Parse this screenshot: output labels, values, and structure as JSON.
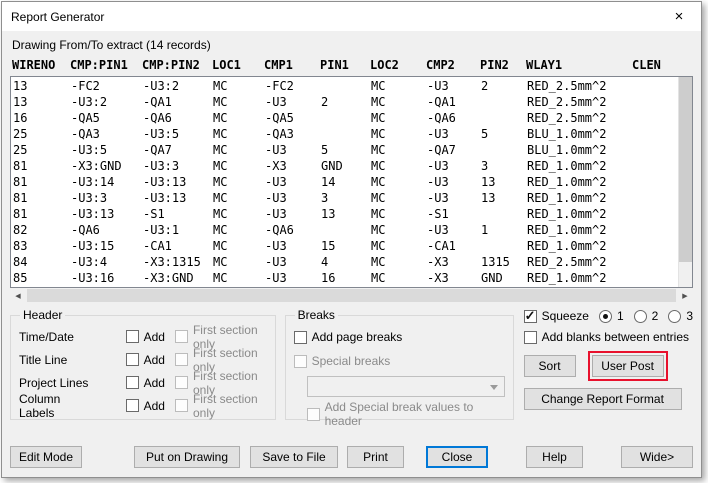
{
  "window": {
    "title": "Report Generator"
  },
  "icons": {
    "close": "×",
    "scroll_left": "◀",
    "scroll_right": "▶"
  },
  "subtitle": "Drawing From/To extract (14 records)",
  "table": {
    "headers": [
      "WIRENO",
      "CMP:PIN1",
      "CMP:PIN2",
      "LOC1",
      "CMP1",
      "PIN1",
      "LOC2",
      "CMP2",
      "PIN2",
      "WLAY1",
      "CLEN"
    ],
    "rows": [
      [
        "13",
        "-FC2",
        "-U3:2",
        "MC",
        "-FC2",
        "",
        "MC",
        "-U3",
        "2",
        "RED_2.5mm^2"
      ],
      [
        "13",
        "-U3:2",
        "-QA1",
        "MC",
        "-U3",
        "2",
        "MC",
        "-QA1",
        "",
        "RED_2.5mm^2"
      ],
      [
        "16",
        "-QA5",
        "-QA6",
        "MC",
        "-QA5",
        "",
        "MC",
        "-QA6",
        "",
        "RED_2.5mm^2"
      ],
      [
        "25",
        "-QA3",
        "-U3:5",
        "MC",
        "-QA3",
        "",
        "MC",
        "-U3",
        "5",
        "BLU_1.0mm^2"
      ],
      [
        "25",
        "-U3:5",
        "-QA7",
        "MC",
        "-U3",
        "5",
        "MC",
        "-QA7",
        "",
        "BLU_1.0mm^2"
      ],
      [
        "81",
        "-X3:GND",
        "-U3:3",
        "MC",
        "-X3",
        "GND",
        "MC",
        "-U3",
        "3",
        "RED_1.0mm^2"
      ],
      [
        "81",
        "-U3:14",
        "-U3:13",
        "MC",
        "-U3",
        "14",
        "MC",
        "-U3",
        "13",
        "RED_1.0mm^2"
      ],
      [
        "81",
        "-U3:3",
        "-U3:13",
        "MC",
        "-U3",
        "3",
        "MC",
        "-U3",
        "13",
        "RED_1.0mm^2"
      ],
      [
        "81",
        "-U3:13",
        "-S1",
        "MC",
        "-U3",
        "13",
        "MC",
        "-S1",
        "",
        "RED_1.0mm^2"
      ],
      [
        "82",
        "-QA6",
        "-U3:1",
        "MC",
        "-QA6",
        "",
        "MC",
        "-U3",
        "1",
        "RED_1.0mm^2"
      ],
      [
        "83",
        "-U3:15",
        "-CA1",
        "MC",
        "-U3",
        "15",
        "MC",
        "-CA1",
        "",
        "RED_1.0mm^2"
      ],
      [
        "84",
        "-U3:4",
        "-X3:1315",
        "MC",
        "-U3",
        "4",
        "MC",
        "-X3",
        "1315",
        "RED_2.5mm^2"
      ],
      [
        "85",
        "-U3:16",
        "-X3:GND",
        "MC",
        "-U3",
        "16",
        "MC",
        "-X3",
        "GND",
        "RED_1.0mm^2"
      ]
    ]
  },
  "header_group": {
    "title": "Header",
    "rows": [
      {
        "label": "Time/Date",
        "add": "Add",
        "first": "First section only"
      },
      {
        "label": "Title Line",
        "add": "Add",
        "first": "First section only"
      },
      {
        "label": "Project Lines",
        "add": "Add",
        "first": "First section only"
      },
      {
        "label": "Column Labels",
        "add": "Add",
        "first": "First section only"
      }
    ]
  },
  "breaks_group": {
    "title": "Breaks",
    "add_page_breaks": "Add page breaks",
    "special_breaks": "Special breaks",
    "special_values_label": "Add Special break values to header"
  },
  "right_panel": {
    "squeeze_label": "Squeeze",
    "squeeze_options": [
      "1",
      "2",
      "3"
    ],
    "squeeze_selected_option": "1",
    "add_blanks_label": "Add blanks between entries",
    "sort_label": "Sort",
    "user_post_label": "User Post",
    "change_format_label": "Change Report Format",
    "highlight_color": "#e8112d"
  },
  "bottom": {
    "edit_mode": "Edit Mode",
    "put_on_drawing": "Put on Drawing",
    "save_to_file": "Save to File",
    "print": "Print",
    "close": "Close",
    "help": "Help",
    "wide": "Wide>"
  }
}
